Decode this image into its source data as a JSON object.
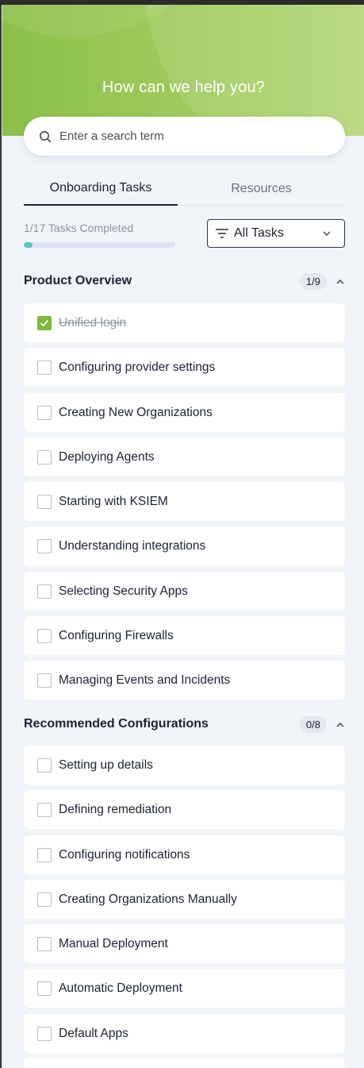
{
  "hero": {
    "title": "How can we help you?"
  },
  "search": {
    "placeholder": "Enter a search term"
  },
  "tabs": [
    {
      "label": "Onboarding Tasks",
      "active": true
    },
    {
      "label": "Resources",
      "active": false
    }
  ],
  "progress": {
    "label": "1/17 Tasks Completed",
    "completed": 1,
    "total": 17
  },
  "filter": {
    "selected": "All Tasks"
  },
  "sections": [
    {
      "title": "Product Overview",
      "count": "1/9",
      "tasks": [
        {
          "label": "Unified login",
          "done": true
        },
        {
          "label": "Configuring provider settings",
          "done": false
        },
        {
          "label": "Creating New Organizations",
          "done": false
        },
        {
          "label": "Deploying Agents",
          "done": false
        },
        {
          "label": "Starting with KSIEM",
          "done": false
        },
        {
          "label": "Understanding integrations",
          "done": false
        },
        {
          "label": "Selecting Security Apps",
          "done": false
        },
        {
          "label": "Configuring Firewalls",
          "done": false
        },
        {
          "label": "Managing Events and Incidents",
          "done": false
        }
      ]
    },
    {
      "title": "Recommended Configurations",
      "count": "0/8",
      "tasks": [
        {
          "label": "Setting up details",
          "done": false
        },
        {
          "label": "Defining remediation",
          "done": false
        },
        {
          "label": "Configuring notifications",
          "done": false
        },
        {
          "label": "Creating Organizations Manually",
          "done": false
        },
        {
          "label": "Manual Deployment",
          "done": false
        },
        {
          "label": "Automatic Deployment",
          "done": false
        },
        {
          "label": "Default Apps",
          "done": false
        },
        {
          "label": "",
          "done": false
        }
      ]
    }
  ],
  "colors": {
    "accent_green": "#7cba3d",
    "progress_teal": "#58c6bf",
    "text_dark": "#1b2233",
    "panel_bg": "#f1f4f8"
  }
}
